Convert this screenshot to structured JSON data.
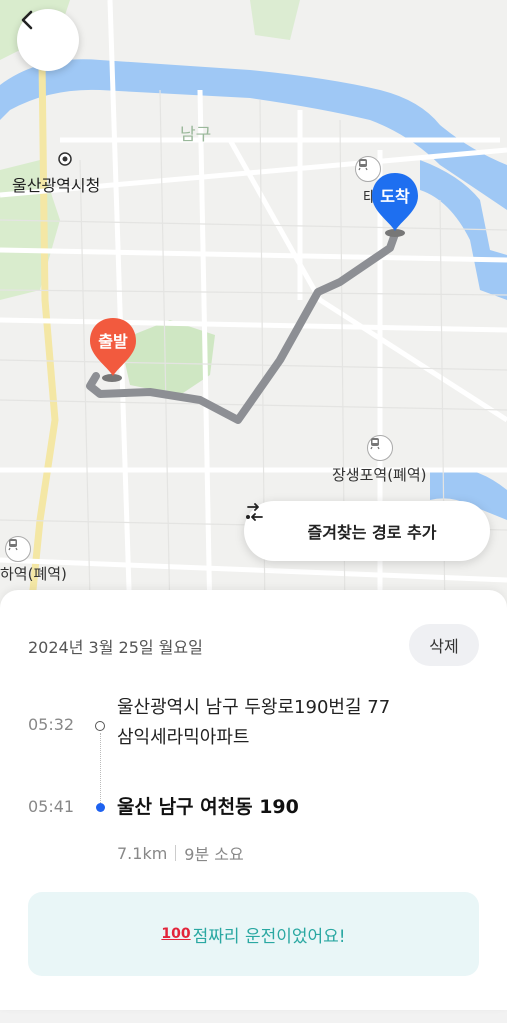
{
  "map": {
    "district_label": "남구",
    "city_hall_label": "울산광역시청",
    "station_partial_label": "태화강",
    "station2_label": "장생포역(폐역)",
    "station3_label": "하역(폐역)",
    "start_pin_label": "출발",
    "end_pin_label": "도착",
    "back_icon": "chevron-left-icon"
  },
  "favorite_route": {
    "label": "즐겨찾는 경로 추가",
    "icon": "route-swap-icon"
  },
  "trip": {
    "date": "2024년 3월 25일 월요일",
    "delete_label": "삭제",
    "origin": {
      "time": "05:32",
      "address_line1": "울산광역시 남구 두왕로190번길 77",
      "address_line2": "삼익세라믹아파트"
    },
    "destination": {
      "time": "05:41",
      "address": "울산 남구 여천동 190"
    },
    "distance": "7.1km",
    "duration": "9분 소요",
    "score_emoji": "100",
    "score_text": "점짜리 운전이었어요!",
    "accent_color": "#1e62f0",
    "banner_text_color": "#2aa8a2"
  }
}
